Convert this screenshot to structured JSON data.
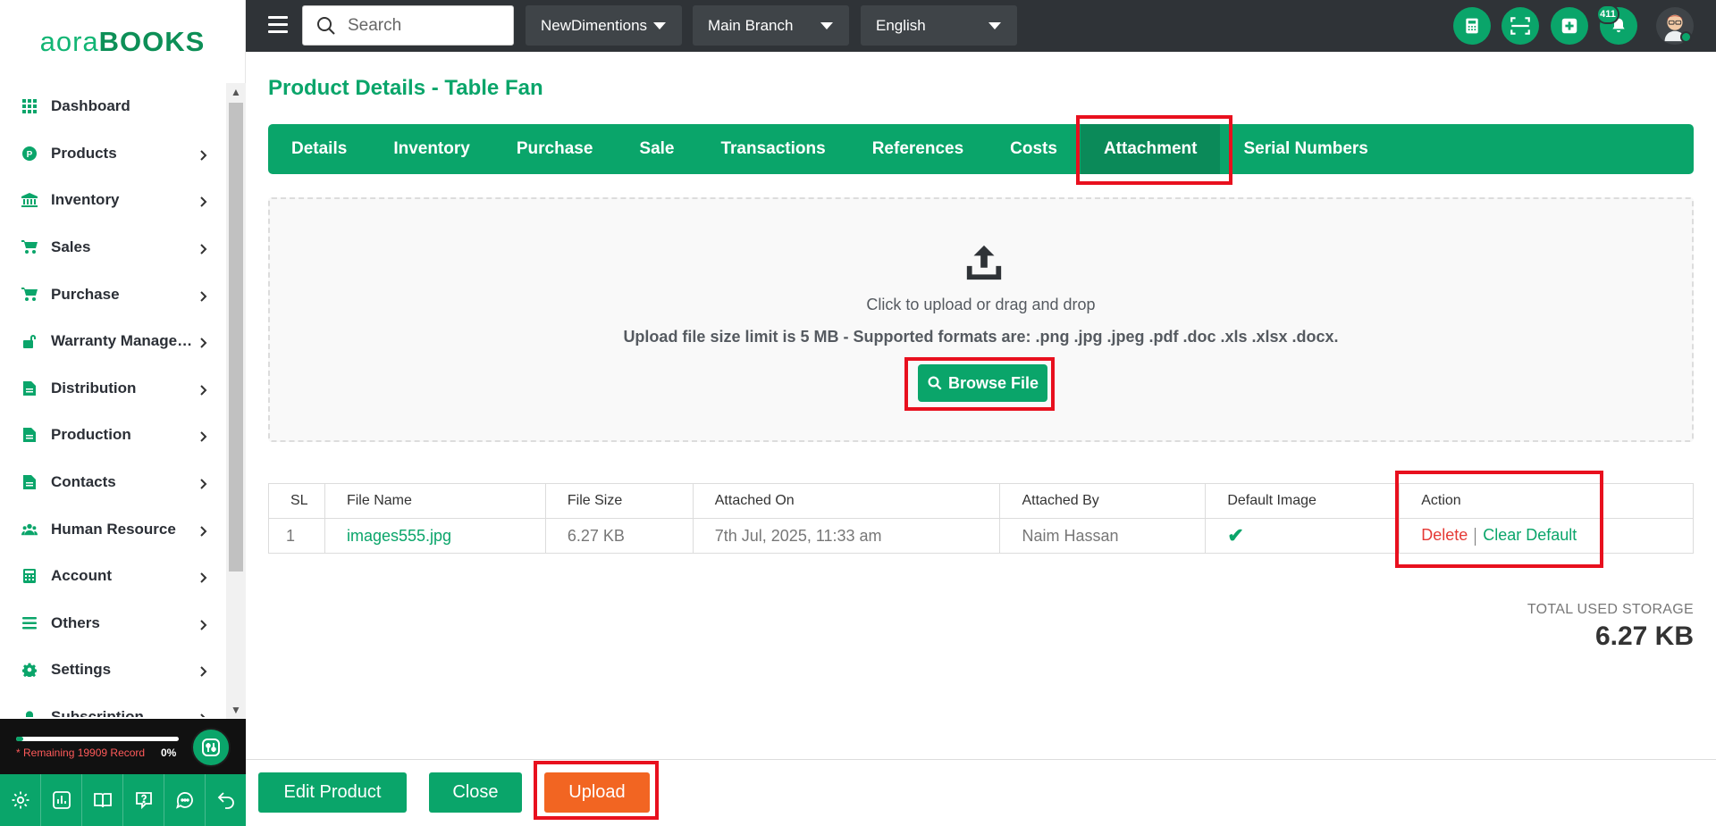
{
  "app": {
    "logo_light": "aora",
    "logo_bold": "BOOKS"
  },
  "sidebar": {
    "items": [
      {
        "label": "Dashboard",
        "icon": "grid-icon",
        "chevron": false
      },
      {
        "label": "Products",
        "icon": "product-icon",
        "chevron": true
      },
      {
        "label": "Inventory",
        "icon": "bank-icon",
        "chevron": true
      },
      {
        "label": "Sales",
        "icon": "cart-icon",
        "chevron": true
      },
      {
        "label": "Purchase",
        "icon": "cart-icon",
        "chevron": true
      },
      {
        "label": "Warranty Management",
        "icon": "unlock-icon",
        "chevron": true
      },
      {
        "label": "Distribution",
        "icon": "document-icon",
        "chevron": true
      },
      {
        "label": "Production",
        "icon": "document-icon",
        "chevron": true
      },
      {
        "label": "Contacts",
        "icon": "document-icon",
        "chevron": true
      },
      {
        "label": "Human Resource",
        "icon": "users-icon",
        "chevron": true
      },
      {
        "label": "Account",
        "icon": "calculator-icon",
        "chevron": true
      },
      {
        "label": "Others",
        "icon": "list-icon",
        "chevron": true
      },
      {
        "label": "Settings",
        "icon": "gear-icon",
        "chevron": true
      },
      {
        "label": "Subscription",
        "icon": "bell-icon",
        "chevron": true
      }
    ],
    "quota_text": "* Remaining 19909 Record",
    "quota_percent": "0%",
    "quota_fraction": 0.0
  },
  "topbar": {
    "search_placeholder": "Search",
    "company": "NewDimentions",
    "branch": "Main Branch",
    "language": "English",
    "notification_count": "411"
  },
  "page": {
    "title": "Product Details - Table Fan",
    "tabs": [
      "Details",
      "Inventory",
      "Purchase",
      "Sale",
      "Transactions",
      "References",
      "Costs",
      "Attachment",
      "Serial Numbers"
    ],
    "active_tab": "Attachment"
  },
  "upload": {
    "line1": "Click to upload or drag and drop",
    "line2": "Upload file size limit is 5 MB - Supported formats are: .png .jpg .jpeg .pdf .doc .xls .xlsx .docx.",
    "browse_label": "Browse File"
  },
  "table": {
    "headers": [
      "SL",
      "File Name",
      "File Size",
      "Attached On",
      "Attached By",
      "Default Image",
      "Action"
    ],
    "rows": [
      {
        "sl": "1",
        "file_name": "images555.jpg",
        "file_size": "6.27 KB",
        "attached_on": "7th Jul, 2025, 11:33 am",
        "attached_by": "Naim Hassan",
        "default_image": true,
        "action_delete": "Delete",
        "action_clear": "Clear Default"
      }
    ]
  },
  "storage": {
    "label": "TOTAL USED STORAGE",
    "value": "6.27 KB"
  },
  "footer": {
    "edit_label": "Edit Product",
    "close_label": "Close",
    "upload_label": "Upload"
  },
  "colors": {
    "brand_green": "#0aa56a",
    "highlight_red": "#e8101e",
    "upload_orange": "#f26522",
    "topbar_dark": "#2f3337"
  }
}
